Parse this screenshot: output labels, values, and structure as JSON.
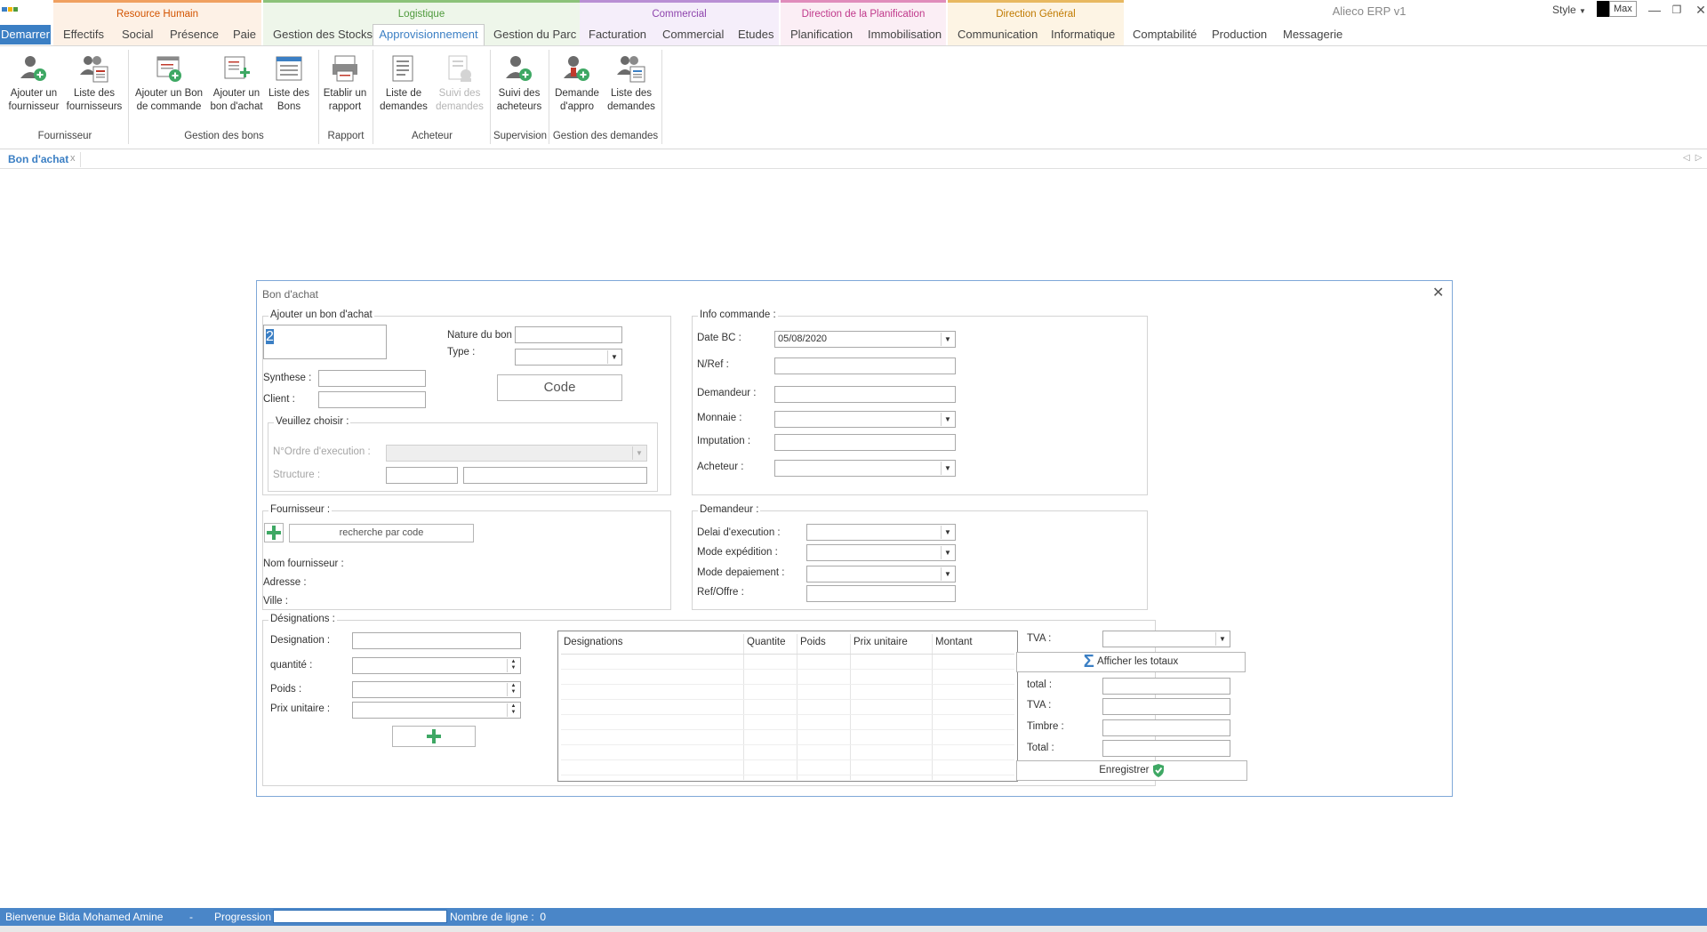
{
  "window": {
    "title": "Alieco ERP v1",
    "style_label": "Style",
    "max_label": "Max"
  },
  "context_tabs": [
    {
      "label": "Resource Humain",
      "color": "#d35400"
    },
    {
      "label": "Logistique",
      "color": "#4e9a3c"
    },
    {
      "label": "Commercial",
      "color": "#8e44ad"
    },
    {
      "label": "Direction de la Planification",
      "color": "#c0398b"
    },
    {
      "label": "Direction Général",
      "color": "#c07a00"
    }
  ],
  "ribbon_tabs": [
    "Demarrer",
    "Effectifs",
    "Social",
    "Présence",
    "Paie",
    "Gestion des Stocks",
    "Approvisionnement",
    "Gestion du Parc",
    "Facturation",
    "Commercial",
    "Etudes",
    "Planification",
    "Immobilisation",
    "Communication",
    "Informatique",
    "Comptabilité",
    "Production",
    "Messagerie"
  ],
  "ribbon": {
    "buttons": [
      {
        "line1": "Ajouter un",
        "line2": "fournisseur",
        "icon": "add-user-icon"
      },
      {
        "line1": "Liste des",
        "line2": "fournisseurs",
        "icon": "users-list-icon"
      },
      {
        "line1": "Ajouter un Bon",
        "line2": "de commande",
        "icon": "add-order-icon"
      },
      {
        "line1": "Ajouter un",
        "line2": "bon d'achat",
        "icon": "add-purchase-icon"
      },
      {
        "line1": "Liste des",
        "line2": "Bons",
        "icon": "list-bons-icon"
      },
      {
        "line1": "Etablir un",
        "line2": "rapport",
        "icon": "report-icon"
      },
      {
        "line1": "Liste de",
        "line2": "demandes",
        "icon": "list-requests-icon"
      },
      {
        "line1": "Suivi des",
        "line2": "demandes",
        "icon": "track-requests-icon"
      },
      {
        "line1": "Suivi des",
        "line2": "acheteurs",
        "icon": "track-buyers-icon"
      },
      {
        "line1": "Demande",
        "line2": "d'appro",
        "icon": "request-supply-icon"
      },
      {
        "line1": "Liste des",
        "line2": "demandes",
        "icon": "list-requests-users-icon"
      }
    ],
    "groups": [
      "Fournisseur",
      "Gestion des bons",
      "Rapport",
      "Acheteur",
      "Supervision",
      "Gestion des demandes"
    ]
  },
  "doc_tab": {
    "label": "Bon d'achat",
    "close": "x"
  },
  "form": {
    "title": "Bon d'achat",
    "close": "✕",
    "ajouter": {
      "title": "Ajouter un bon d'achat",
      "number_value": "2",
      "nature_label": "Nature du bon :",
      "type_label": "Type :",
      "code_button": "Code",
      "synthese_label": "Synthese :",
      "client_label": "Client :",
      "choisir_title": "Veuillez choisir :",
      "ordre_label": "N°Ordre d'execution :",
      "structure_label": "Structure :"
    },
    "info": {
      "title": "Info commande :",
      "date_label": "Date BC :",
      "date_value": "05/08/2020",
      "nref_label": "N/Ref :",
      "demandeur_label": "Demandeur :",
      "monnaie_label": "Monnaie :",
      "imputation_label": "Imputation :",
      "acheteur_label": "Acheteur :"
    },
    "fournisseur": {
      "title": "Fournisseur :",
      "search_button": "recherche par code",
      "nom_label": "Nom fournisseur :",
      "adresse_label": "Adresse :",
      "ville_label": "Ville :"
    },
    "demandeur": {
      "title": "Demandeur :",
      "delai_label": "Delai d'execution :",
      "expedition_label": "Mode expédition :",
      "paiement_label": "Mode depaiement :",
      "ref_label": "Ref/Offre :"
    },
    "designations": {
      "title": "Désignations :",
      "designation_label": "Designation :",
      "quantite_label": "quantité :",
      "poids_label": "Poids :",
      "prix_label": "Prix unitaire  :"
    },
    "grid_columns": [
      "Designations",
      "Quantite",
      "Poids",
      "Prix unitaire",
      "Montant"
    ],
    "totals": {
      "tva_select_label": "TVA :",
      "afficher_button": "Afficher les totaux",
      "total_label": "total :",
      "tva_label": "TVA :",
      "timbre_label": "Timbre :",
      "total2_label": "Total :",
      "enregistrer_button": "Enregistrer"
    }
  },
  "status": {
    "welcome": "Bienvenue Bida Mohamed Amine",
    "dash": "-",
    "progression_label": "Progression",
    "lines_label": "Nombre de ligne :",
    "lines_value": "0"
  }
}
